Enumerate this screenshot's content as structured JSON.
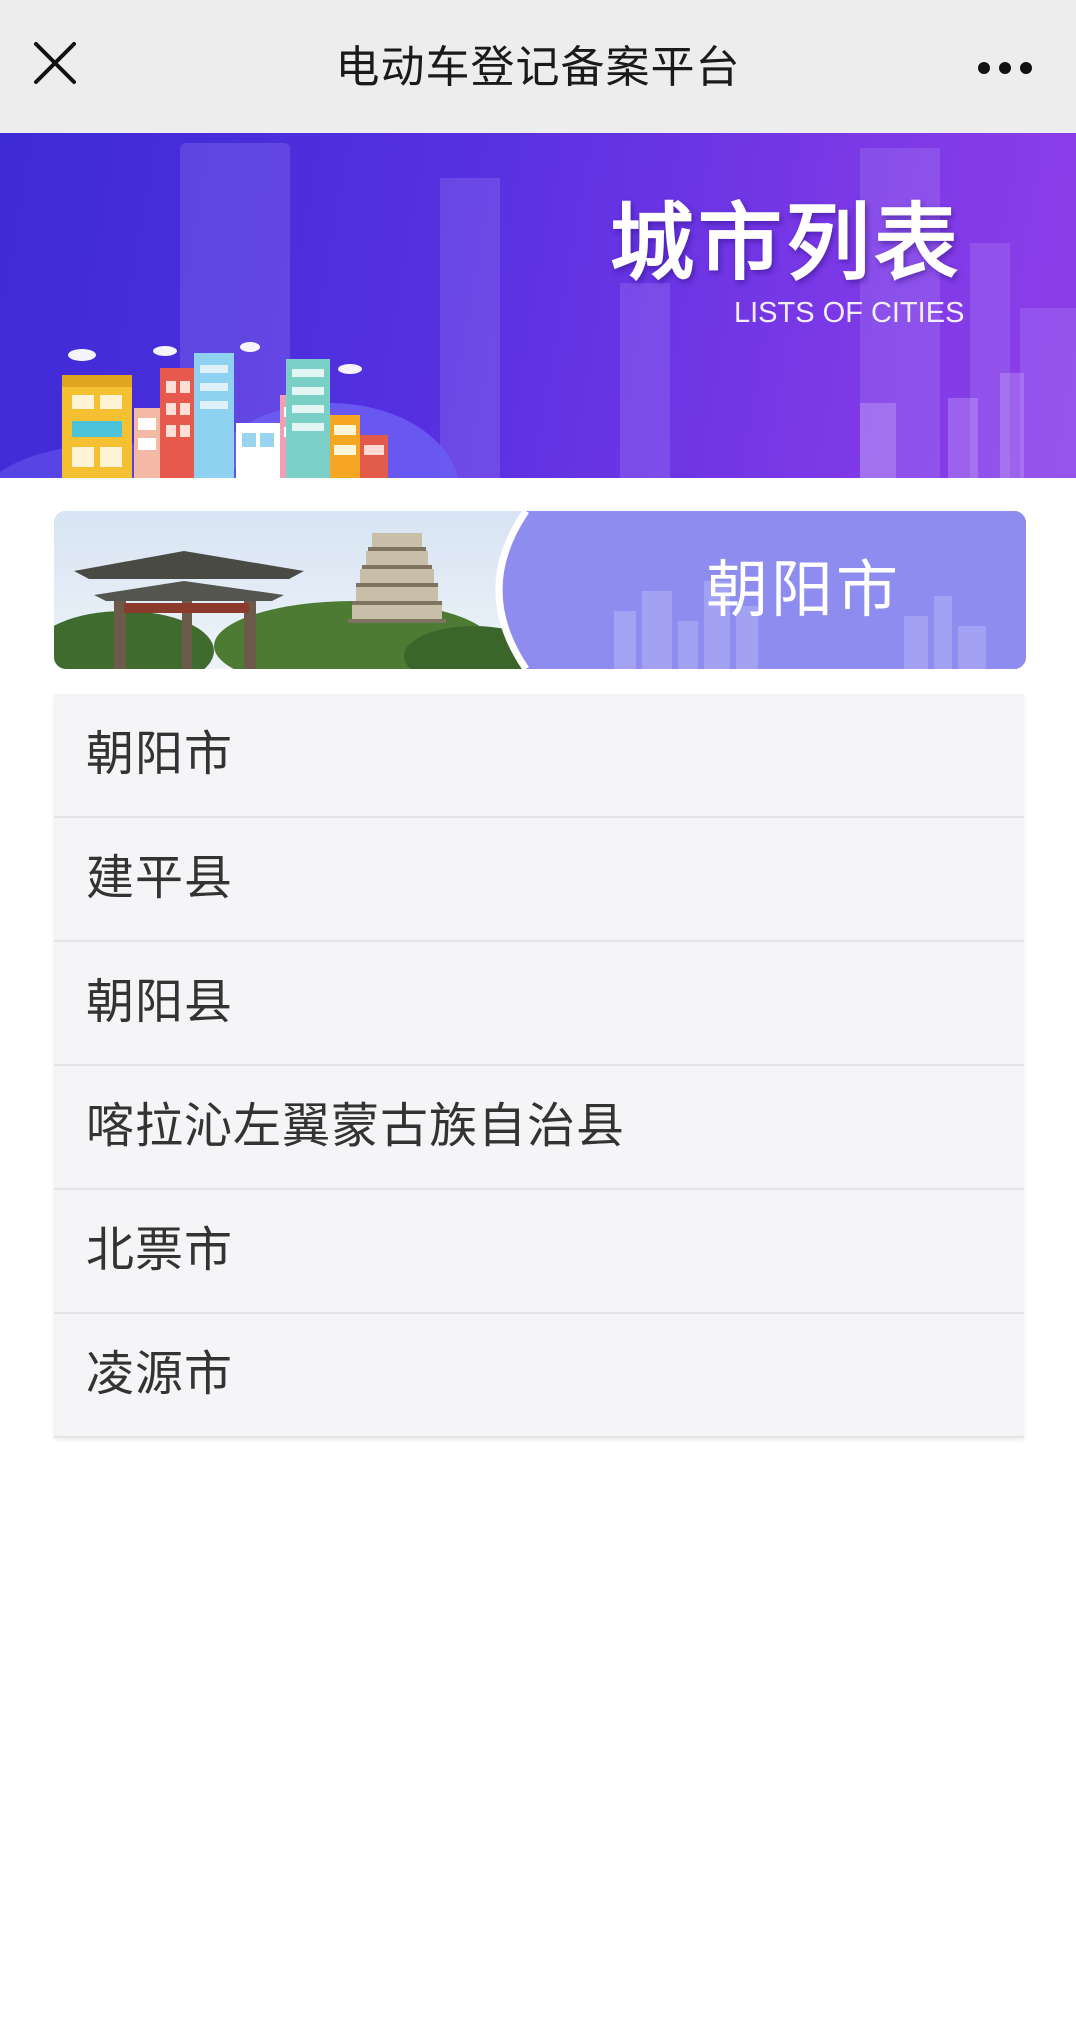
{
  "navbar": {
    "title": "电动车登记备案平台",
    "close_icon": "close-icon",
    "more_icon": "more-dots-icon"
  },
  "hero": {
    "title": "城市列表",
    "subtitle": "LISTS OF CITIES"
  },
  "city_card": {
    "name": "朝阳市"
  },
  "city_list": {
    "items": [
      {
        "label": "朝阳市"
      },
      {
        "label": "建平县"
      },
      {
        "label": "朝阳县"
      },
      {
        "label": "喀拉沁左翼蒙古族自治县"
      },
      {
        "label": "北票市"
      },
      {
        "label": "凌源市"
      }
    ]
  },
  "colors": {
    "navbar_bg": "#ededed",
    "hero_gradient_start": "#3d2bd6",
    "hero_gradient_end": "#8d3fe8",
    "list_bg": "#f5f5f7",
    "text_primary": "#333333"
  }
}
